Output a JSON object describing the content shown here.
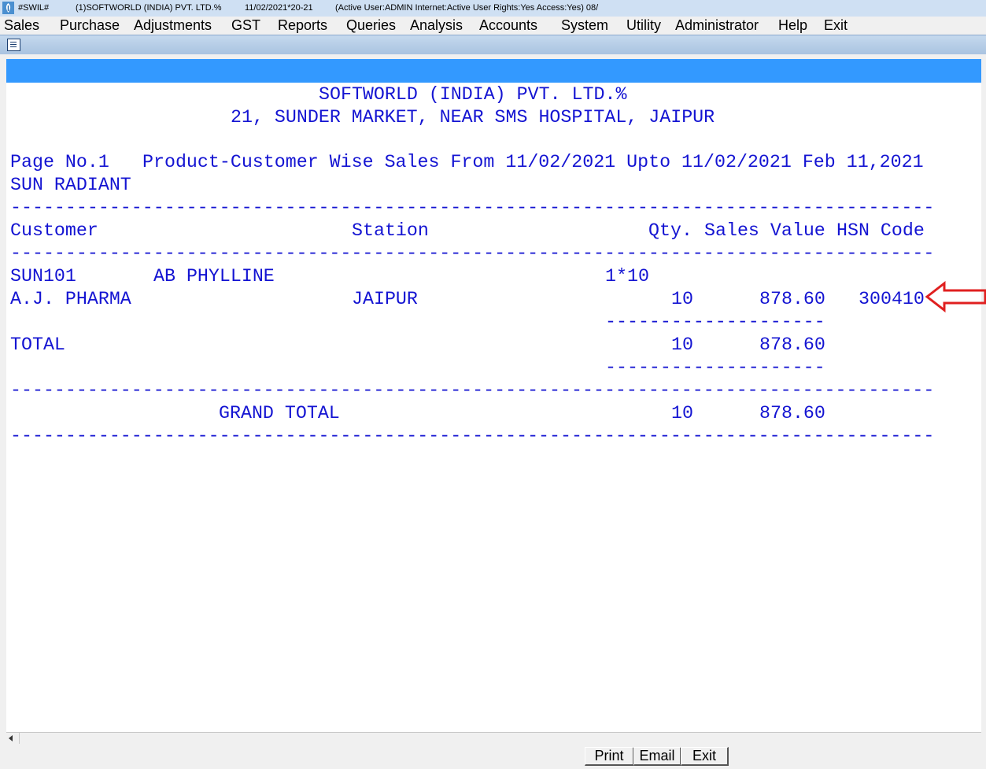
{
  "titlebar": {
    "app": "#SWIL#",
    "company": "(1)SOFTWORLD (INDIA) PVT. LTD.%",
    "date": "11/02/2021*20-21",
    "status": "(Active User:ADMIN Internet:Active  User Rights:Yes Access:Yes) 08/"
  },
  "menu": [
    "Sales",
    "Purchase",
    "Adjustments",
    "GST",
    "Reports",
    "Queries",
    "Analysis",
    "Accounts",
    "System",
    "Utility",
    "Administrator",
    "Help",
    "Exit"
  ],
  "report": {
    "company_name": "SOFTWORLD (INDIA) PVT. LTD.%",
    "address": "21, SUNDER MARKET, NEAR SMS HOSPITAL, JAIPUR",
    "page_no": "Page No.1",
    "report_title": "Product-Customer Wise Sales From 11/02/2021 Upto 11/02/2021 Feb 11,2021",
    "group": "SUN RADIANT",
    "col_customer": "Customer",
    "col_station": "Station",
    "col_qty": "Qty.",
    "col_sales_value": "Sales Value",
    "col_hsn": "HSN Code",
    "product_code": "SUN101",
    "product_name": "AB PHYLLINE",
    "pack": "1*10",
    "customer": "A.J. PHARMA",
    "station": "JAIPUR",
    "qty": "10",
    "sales_value": "878.60",
    "hsn": "300410",
    "total_label": "TOTAL",
    "total_qty": "10",
    "total_value": "878.60",
    "grand_label": "GRAND TOTAL",
    "grand_qty": "10",
    "grand_value": "878.60",
    "full_rule": "------------------------------------------------------------------------------------",
    "sub_rule": "--------------------"
  },
  "buttons": {
    "print": "Print",
    "email": "Email",
    "exit": "Exit"
  },
  "colors": {
    "report_text": "#1414d2",
    "band": "#3399ff",
    "arrow": "#e02020"
  }
}
